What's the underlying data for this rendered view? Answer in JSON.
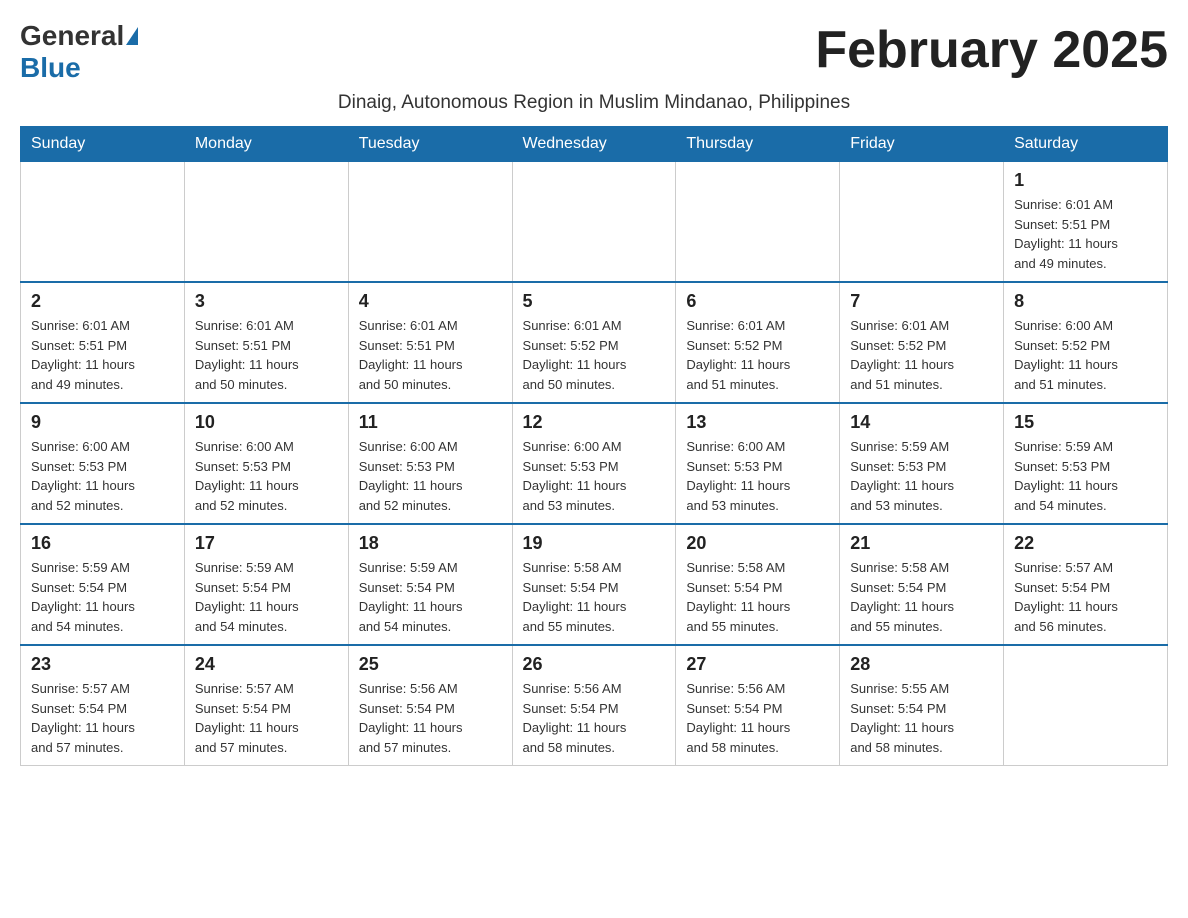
{
  "header": {
    "logo_general": "General",
    "logo_blue": "Blue",
    "month_title": "February 2025",
    "subtitle": "Dinaig, Autonomous Region in Muslim Mindanao, Philippines"
  },
  "days_of_week": [
    "Sunday",
    "Monday",
    "Tuesday",
    "Wednesday",
    "Thursday",
    "Friday",
    "Saturday"
  ],
  "weeks": [
    {
      "days": [
        {
          "num": "",
          "info": ""
        },
        {
          "num": "",
          "info": ""
        },
        {
          "num": "",
          "info": ""
        },
        {
          "num": "",
          "info": ""
        },
        {
          "num": "",
          "info": ""
        },
        {
          "num": "",
          "info": ""
        },
        {
          "num": "1",
          "info": "Sunrise: 6:01 AM\nSunset: 5:51 PM\nDaylight: 11 hours\nand 49 minutes."
        }
      ]
    },
    {
      "days": [
        {
          "num": "2",
          "info": "Sunrise: 6:01 AM\nSunset: 5:51 PM\nDaylight: 11 hours\nand 49 minutes."
        },
        {
          "num": "3",
          "info": "Sunrise: 6:01 AM\nSunset: 5:51 PM\nDaylight: 11 hours\nand 50 minutes."
        },
        {
          "num": "4",
          "info": "Sunrise: 6:01 AM\nSunset: 5:51 PM\nDaylight: 11 hours\nand 50 minutes."
        },
        {
          "num": "5",
          "info": "Sunrise: 6:01 AM\nSunset: 5:52 PM\nDaylight: 11 hours\nand 50 minutes."
        },
        {
          "num": "6",
          "info": "Sunrise: 6:01 AM\nSunset: 5:52 PM\nDaylight: 11 hours\nand 51 minutes."
        },
        {
          "num": "7",
          "info": "Sunrise: 6:01 AM\nSunset: 5:52 PM\nDaylight: 11 hours\nand 51 minutes."
        },
        {
          "num": "8",
          "info": "Sunrise: 6:00 AM\nSunset: 5:52 PM\nDaylight: 11 hours\nand 51 minutes."
        }
      ]
    },
    {
      "days": [
        {
          "num": "9",
          "info": "Sunrise: 6:00 AM\nSunset: 5:53 PM\nDaylight: 11 hours\nand 52 minutes."
        },
        {
          "num": "10",
          "info": "Sunrise: 6:00 AM\nSunset: 5:53 PM\nDaylight: 11 hours\nand 52 minutes."
        },
        {
          "num": "11",
          "info": "Sunrise: 6:00 AM\nSunset: 5:53 PM\nDaylight: 11 hours\nand 52 minutes."
        },
        {
          "num": "12",
          "info": "Sunrise: 6:00 AM\nSunset: 5:53 PM\nDaylight: 11 hours\nand 53 minutes."
        },
        {
          "num": "13",
          "info": "Sunrise: 6:00 AM\nSunset: 5:53 PM\nDaylight: 11 hours\nand 53 minutes."
        },
        {
          "num": "14",
          "info": "Sunrise: 5:59 AM\nSunset: 5:53 PM\nDaylight: 11 hours\nand 53 minutes."
        },
        {
          "num": "15",
          "info": "Sunrise: 5:59 AM\nSunset: 5:53 PM\nDaylight: 11 hours\nand 54 minutes."
        }
      ]
    },
    {
      "days": [
        {
          "num": "16",
          "info": "Sunrise: 5:59 AM\nSunset: 5:54 PM\nDaylight: 11 hours\nand 54 minutes."
        },
        {
          "num": "17",
          "info": "Sunrise: 5:59 AM\nSunset: 5:54 PM\nDaylight: 11 hours\nand 54 minutes."
        },
        {
          "num": "18",
          "info": "Sunrise: 5:59 AM\nSunset: 5:54 PM\nDaylight: 11 hours\nand 54 minutes."
        },
        {
          "num": "19",
          "info": "Sunrise: 5:58 AM\nSunset: 5:54 PM\nDaylight: 11 hours\nand 55 minutes."
        },
        {
          "num": "20",
          "info": "Sunrise: 5:58 AM\nSunset: 5:54 PM\nDaylight: 11 hours\nand 55 minutes."
        },
        {
          "num": "21",
          "info": "Sunrise: 5:58 AM\nSunset: 5:54 PM\nDaylight: 11 hours\nand 55 minutes."
        },
        {
          "num": "22",
          "info": "Sunrise: 5:57 AM\nSunset: 5:54 PM\nDaylight: 11 hours\nand 56 minutes."
        }
      ]
    },
    {
      "days": [
        {
          "num": "23",
          "info": "Sunrise: 5:57 AM\nSunset: 5:54 PM\nDaylight: 11 hours\nand 57 minutes."
        },
        {
          "num": "24",
          "info": "Sunrise: 5:57 AM\nSunset: 5:54 PM\nDaylight: 11 hours\nand 57 minutes."
        },
        {
          "num": "25",
          "info": "Sunrise: 5:56 AM\nSunset: 5:54 PM\nDaylight: 11 hours\nand 57 minutes."
        },
        {
          "num": "26",
          "info": "Sunrise: 5:56 AM\nSunset: 5:54 PM\nDaylight: 11 hours\nand 58 minutes."
        },
        {
          "num": "27",
          "info": "Sunrise: 5:56 AM\nSunset: 5:54 PM\nDaylight: 11 hours\nand 58 minutes."
        },
        {
          "num": "28",
          "info": "Sunrise: 5:55 AM\nSunset: 5:54 PM\nDaylight: 11 hours\nand 58 minutes."
        },
        {
          "num": "",
          "info": ""
        }
      ]
    }
  ]
}
